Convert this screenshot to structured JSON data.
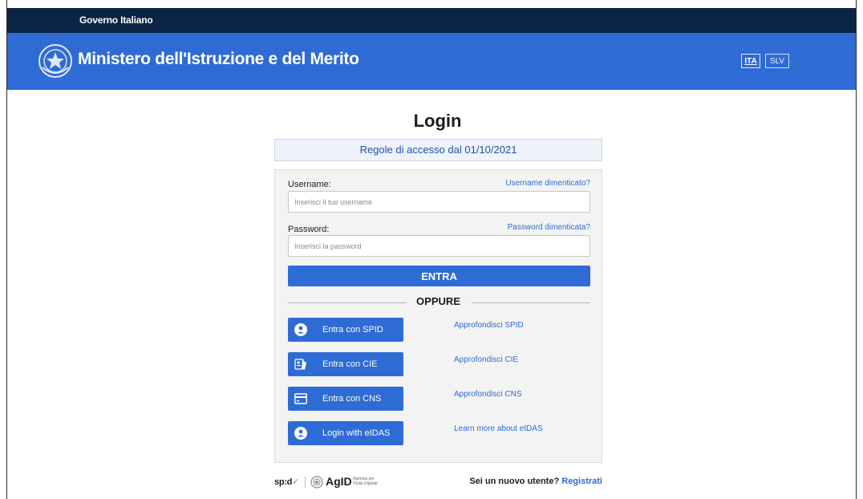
{
  "government_bar": {
    "label": "Governo Italiano"
  },
  "header": {
    "ministry_title": "Ministero dell'Istruzione e del Merito",
    "languages": [
      {
        "code": "ITA",
        "active": true
      },
      {
        "code": "SLV",
        "active": false
      }
    ]
  },
  "login": {
    "title": "Login",
    "access_rules_link": "Regole di accesso dal 01/10/2021",
    "username": {
      "label": "Username:",
      "placeholder": "Inserisci il tuo username",
      "value": "",
      "forgot_link": "Username dimenticato?"
    },
    "password": {
      "label": "Password:",
      "placeholder": "Inserisci la password",
      "value": "",
      "forgot_link": "Password dimenticata?"
    },
    "submit_label": "ENTRA",
    "separator_label": "OPPURE",
    "alt_methods": [
      {
        "label": "Entra con SPID",
        "icon": "spid-user-icon",
        "more_link": "Approfondisci SPID"
      },
      {
        "label": "Entra con CIE",
        "icon": "cie-card-icon",
        "more_link": "Approfondisci CIE"
      },
      {
        "label": "Entra con CNS",
        "icon": "cns-card-icon",
        "more_link": "Approfondisci CNS"
      },
      {
        "label": "Login with eIDAS",
        "icon": "eidas-user-icon",
        "more_link": "Learn more about eIDAS"
      }
    ]
  },
  "footer": {
    "spid_logo_text": "sp:d",
    "agid_logo_text": "AgID",
    "agid_subtitle": "Agenzia per l'Italia Digitale",
    "register_prompt": "Sei un nuovo utente?",
    "register_link": "Registrati"
  },
  "colors": {
    "government_bar": "#0b2545",
    "header": "#2f6bd4",
    "primary_button": "#2f6bd4",
    "link": "#2f6bd4",
    "card_background": "#f3f3f3",
    "notice_background": "#eef3fa"
  }
}
